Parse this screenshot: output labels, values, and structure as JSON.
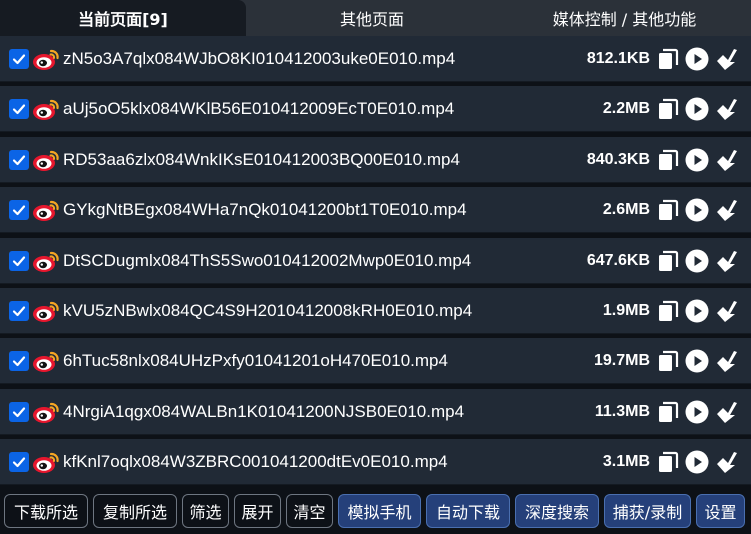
{
  "tabs": [
    {
      "label": "当前页面[9]"
    },
    {
      "label": "其他页面"
    },
    {
      "label": "媒体控制 / 其他功能"
    }
  ],
  "colors": {
    "accent": "#0b64e6",
    "weibo_red": "#e6162d",
    "weibo_orange": "#f5a623"
  },
  "files": [
    {
      "name": "zN5o3A7qlx084WJbO8KI010412003uke0E010.mp4",
      "size": "812.1KB",
      "checked": true
    },
    {
      "name": "aUj5oO5klx084WKlB56E010412009EcT0E010.mp4",
      "size": "2.2MB",
      "checked": true
    },
    {
      "name": "RD53aa6zlx084WnkIKsE010412003BQ00E010.mp4",
      "size": "840.3KB",
      "checked": true
    },
    {
      "name": "GYkgNtBEgx084WHa7nQk01041200bt1T0E010.mp4",
      "size": "2.6MB",
      "checked": true
    },
    {
      "name": "DtSCDugmlx084ThS5Swo010412002Mwp0E010.mp4",
      "size": "647.6KB",
      "checked": true
    },
    {
      "name": "kVU5zNBwlx084QC4S9H2010412008kRH0E010.mp4",
      "size": "1.9MB",
      "checked": true
    },
    {
      "name": "6hTuc58nlx084UHzPxfy01041201oH470E010.mp4",
      "size": "19.7MB",
      "checked": true
    },
    {
      "name": "4NrgiA1qgx084WALBn1K01041200NJSB0E010.mp4",
      "size": "11.3MB",
      "checked": true
    },
    {
      "name": "kfKnl7oqlx084W3ZBRC001041200dtEv0E010.mp4",
      "size": "3.1MB",
      "checked": true
    }
  ],
  "row_icons": [
    "weibo-icon",
    "copy-icon",
    "play-icon",
    "download-icon"
  ],
  "toolbar": {
    "download_selected": "下载所选",
    "copy_selected": "复制所选",
    "filter": "筛选",
    "expand": "展开",
    "clear": "清空",
    "mobile_emulation": "模拟手机",
    "auto_download": "自动下载",
    "deep_search": "深度搜索",
    "capture_record": "捕获/录制",
    "settings": "设置"
  }
}
